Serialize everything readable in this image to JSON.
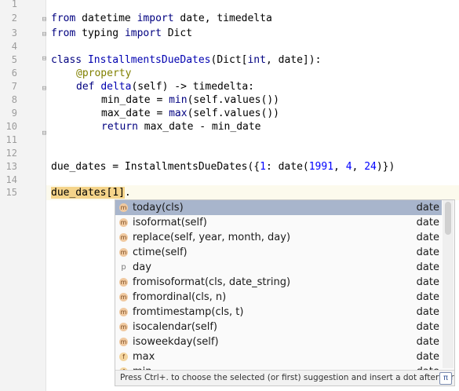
{
  "editor": {
    "line_numbers": [
      "1",
      "2",
      "3",
      "4",
      "5",
      "6",
      "7",
      "8",
      "9",
      "10",
      "11",
      "12",
      "13",
      "14",
      "15"
    ],
    "line2": {
      "k1": "from",
      "t1": " datetime ",
      "k2": "import",
      "t2": " date, timedelta"
    },
    "line3": {
      "k1": "from",
      "t1": " typing ",
      "k2": "import",
      "t2": " Dict"
    },
    "line5": {
      "k1": "class",
      "sp": " ",
      "name": "InstallmentsDueDates",
      "t1": "(Dict[",
      "bi1": "int",
      "t2": ", date]):"
    },
    "line6": {
      "dec": "@property"
    },
    "line7": {
      "k1": "def",
      "sp": " ",
      "name": "delta",
      "t1": "(self) -> timedelta:"
    },
    "line8": {
      "t1": "min_date = ",
      "bi": "min",
      "t2": "(self.values())"
    },
    "line9": {
      "t1": "max_date = ",
      "bi": "max",
      "t2": "(self.values())"
    },
    "line10": {
      "k1": "return",
      "t1": " max_date - min_date"
    },
    "line13": {
      "t1": "due_dates = InstallmentsDueDates({",
      "n1": "1",
      "t2": ": date(",
      "n2": "1991",
      "t3": ", ",
      "n3": "4",
      "t4": ", ",
      "n4": "24",
      "t5": ")})"
    },
    "line15": {
      "hl": "due_dates[1]",
      "t1": "."
    }
  },
  "completion": {
    "items": [
      {
        "icon": "m",
        "label": "today(cls)",
        "type": "date",
        "selected": true
      },
      {
        "icon": "m",
        "label": "isoformat(self)",
        "type": "date"
      },
      {
        "icon": "m",
        "label": "replace(self, year, month, day)",
        "type": "date"
      },
      {
        "icon": "m",
        "label": "ctime(self)",
        "type": "date"
      },
      {
        "icon": "p",
        "label": "day",
        "type": "date"
      },
      {
        "icon": "m",
        "label": "fromisoformat(cls, date_string)",
        "type": "date"
      },
      {
        "icon": "m",
        "label": "fromordinal(cls, n)",
        "type": "date"
      },
      {
        "icon": "m",
        "label": "fromtimestamp(cls, t)",
        "type": "date"
      },
      {
        "icon": "m",
        "label": "isocalendar(self)",
        "type": "date"
      },
      {
        "icon": "m",
        "label": "isoweekday(self)",
        "type": "date"
      },
      {
        "icon": "f",
        "label": "max",
        "type": "date"
      },
      {
        "icon": "f",
        "label": "min",
        "type": "date"
      }
    ],
    "hint": "Press Ctrl+. to choose the selected (or first) suggestion and insert a dot afterwards",
    "hint_icon": "π"
  }
}
